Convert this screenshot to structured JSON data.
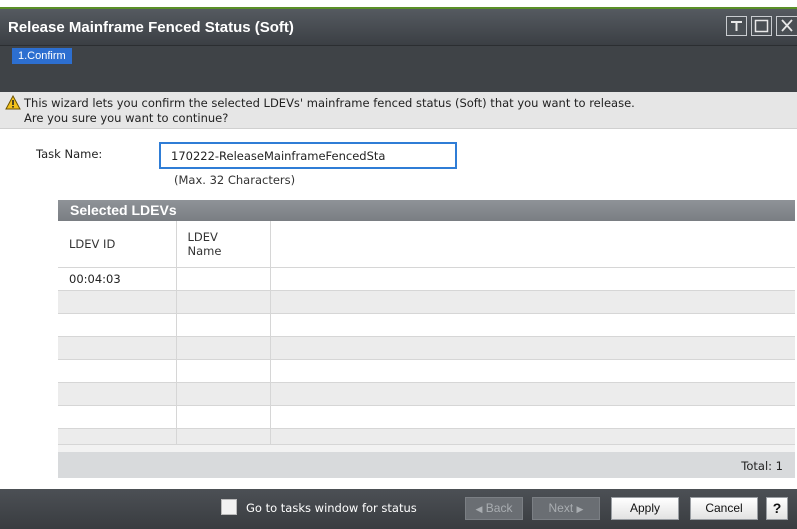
{
  "window": {
    "title": "Release Mainframe Fenced Status (Soft)",
    "pin_icon": "pin-icon",
    "maximize_icon": "maximize-icon",
    "close_icon": "close-icon"
  },
  "steps": [
    {
      "label": "1.Confirm",
      "active": true
    }
  ],
  "info": {
    "icon": "warning-icon",
    "line1": "This wizard lets you confirm the selected LDEVs' mainframe fenced status (Soft) that you want to release.",
    "line2": "Are you sure you want to continue?"
  },
  "task": {
    "label": "Task Name:",
    "value": "170222-ReleaseMainframeFencedSta",
    "hint": "(Max. 32 Characters)"
  },
  "selected": {
    "title": "Selected LDEVs",
    "columns": [
      "LDEV ID",
      "LDEV Name",
      ""
    ],
    "rows": [
      [
        "00:04:03",
        "",
        ""
      ],
      [
        "",
        "",
        ""
      ],
      [
        "",
        "",
        ""
      ],
      [
        "",
        "",
        ""
      ],
      [
        "",
        "",
        ""
      ],
      [
        "",
        "",
        ""
      ],
      [
        "",
        "",
        ""
      ],
      [
        "",
        "",
        ""
      ]
    ],
    "total_label": "Total:",
    "total_value": "1"
  },
  "footer": {
    "checkbox_label": "Go to tasks window for status",
    "checkbox_checked": false,
    "back_label": "Back",
    "next_label": "Next",
    "apply_label": "Apply",
    "cancel_label": "Cancel",
    "help_label": "?"
  },
  "colors": {
    "accent_blue": "#2d6fd0",
    "title_bar": "#3b3f44",
    "input_border": "#2f7dd6"
  }
}
